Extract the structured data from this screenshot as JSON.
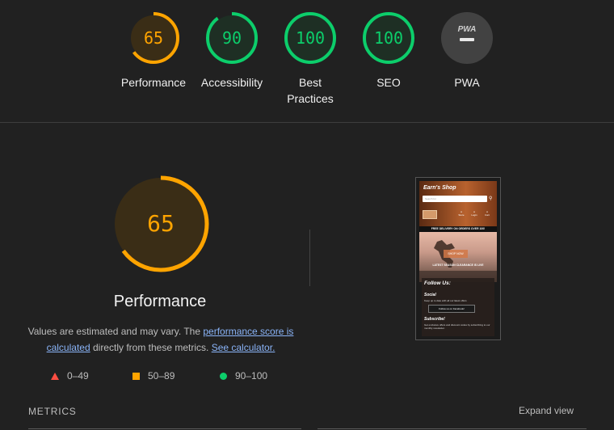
{
  "summary_gauges": [
    {
      "score": "65",
      "fraction": 0.65,
      "label": "Performance",
      "color": "#ffa400",
      "bg": "#3a2d16"
    },
    {
      "score": "90",
      "fraction": 0.9,
      "label": "Accessibility",
      "color": "#0cce6b",
      "bg": "#1e2f24"
    },
    {
      "score": "100",
      "fraction": 1.0,
      "label": "Best Practices",
      "color": "#0cce6b",
      "bg": "#1e2f24"
    },
    {
      "score": "100",
      "fraction": 1.0,
      "label": "SEO",
      "color": "#0cce6b",
      "bg": "#1e2f24"
    },
    {
      "score": "PWA",
      "fraction": 0,
      "label": "PWA",
      "color": "#9e9e9e",
      "bg": "#424242",
      "icon": "pwa-badge-icon"
    }
  ],
  "performance": {
    "score": "65",
    "fraction": 0.65,
    "title": "Performance",
    "desc_prefix": "Values are estimated and may vary. The ",
    "link_score": "performance score is calculated",
    "desc_middle": " directly from these metrics. ",
    "link_calc": "See calculator."
  },
  "legend": [
    {
      "range": "0–49",
      "shape": "triangle",
      "color": "#ff4e42"
    },
    {
      "range": "50–89",
      "shape": "square",
      "color": "#ffa400"
    },
    {
      "range": "90–100",
      "shape": "circle",
      "color": "#0cce6b"
    }
  ],
  "screenshot": {
    "brand": "Earn's Shop",
    "search_placeholder": "Search for",
    "nav": [
      "Store",
      "Login",
      "Cart"
    ],
    "banner": "FREE DELIVERY ON ORDERS OVER 100!",
    "shop_button": "SHOP NOW",
    "hero_text": "LATEST SEASON CLEARANCE IS LIVE",
    "follow_title": "Follow Us:",
    "social_heading": "Social",
    "social_text": "Keep up to date with all our latest offers",
    "facebook_button": "Follow us on Facebook!",
    "subscribe_heading": "Subscribe!",
    "subscribe_text": "Get exclusive offers and discount codes by subscribing to our monthly newsletter."
  },
  "metrics": {
    "label": "METRICS",
    "expand": "Expand view"
  }
}
